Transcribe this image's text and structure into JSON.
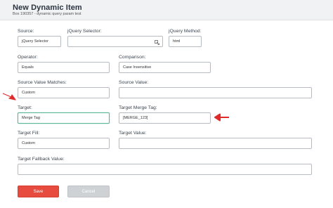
{
  "header": {
    "title": "New Dynamic Item",
    "subtitle": "Box 190357 - dynamic query param test"
  },
  "form": {
    "source": {
      "label": "Source:",
      "value": "jQuery Selector"
    },
    "jquery_selector": {
      "label": "jQuery Selector:",
      "value": ""
    },
    "jquery_method": {
      "label": "jQuery Method:",
      "value": "html"
    },
    "operator": {
      "label": "Operator:",
      "value": "Equals"
    },
    "comparison": {
      "label": "Comparison:",
      "value": "Case Insensitive"
    },
    "source_value_matches": {
      "label": "Source Value Matches:",
      "value": "Custom"
    },
    "source_value": {
      "label": "Source Value:",
      "value": ""
    },
    "target": {
      "label": "Target:",
      "value": "Merge Tag"
    },
    "target_merge_tag": {
      "label": "Target Merge Tag:",
      "value": "[MERGE_123]"
    },
    "target_fill": {
      "label": "Target Fill:",
      "value": "Custom"
    },
    "target_value": {
      "label": "Target Value:",
      "value": ""
    },
    "target_fallback_value": {
      "label": "Target Fallback Value:",
      "value": ""
    }
  },
  "actions": {
    "save_label": "Save",
    "cancel_label": "Cancel"
  },
  "colors": {
    "save": "#e64b3e",
    "cancel": "#cfd2d5",
    "focus": "#59b89a",
    "arrow": "#e02b2b"
  },
  "icons": {
    "selector_picker": "picker-icon",
    "annotation": "red-arrow-icon"
  }
}
